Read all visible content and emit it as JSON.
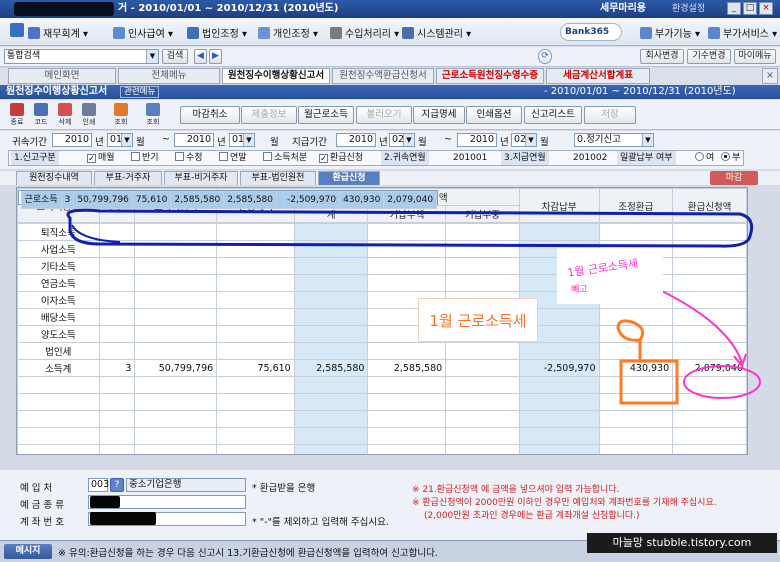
{
  "titlebar": {
    "title": "거 - 2010/01/01 ~ 2010/12/31 (2010년도)",
    "company": "세무마리용",
    "env": "환경설정"
  },
  "menu": [
    "재무회계",
    "인사급여",
    "법인조정",
    "개인조정",
    "수입처리리",
    "시스템관리",
    "Bank365",
    "부가기능",
    "부가서비스"
  ],
  "searchbar": {
    "search_label": "통합검색",
    "search_btn": "검색",
    "right_buttons": [
      "회사변경",
      "기수변경",
      "마이메뉴"
    ]
  },
  "tabs": [
    {
      "label": "메인화면",
      "state": "normal"
    },
    {
      "label": "전체메뉴",
      "state": "normal"
    },
    {
      "label": "원천징수이행상황신고서",
      "state": "active"
    },
    {
      "label": "원천징수액환급신청서",
      "state": "normal"
    },
    {
      "label": "근로소득원천징수영수증",
      "state": "red"
    },
    {
      "label": "세금계산서합계표",
      "state": "red"
    }
  ],
  "form_header": {
    "title": "원천징수이행상황신고서",
    "menu": "관련메뉴",
    "period": "- 2010/01/01 ~ 2010/12/31 (2010년도)"
  },
  "toolbar": {
    "icons": [
      "종료",
      "코드",
      "삭제",
      "인쇄",
      "조회",
      "조회"
    ],
    "buttons": [
      {
        "label": "마감취소",
        "enabled": true
      },
      {
        "label": "제출정보",
        "enabled": false
      },
      {
        "label": "월근로소득",
        "enabled": true
      },
      {
        "label": "불러오기",
        "enabled": false
      },
      {
        "label": "지급명세",
        "enabled": true
      },
      {
        "label": "인쇄옵션",
        "enabled": true
      },
      {
        "label": "신고리스트",
        "enabled": true
      },
      {
        "label": "저장",
        "enabled": false
      }
    ]
  },
  "filter": {
    "attr_label": "귀속기간",
    "pay_label": "지급기간",
    "attr_from_year": "2010",
    "attr_from_month": "01",
    "attr_to_year": "2010",
    "attr_to_month": "01",
    "pay_from_year": "2010",
    "pay_from_month": "02",
    "pay_to_year": "2010",
    "pay_to_month": "02",
    "year_unit": "년",
    "month_unit": "월",
    "tilde": "~",
    "report_type": "0.정기신고",
    "row2": {
      "declare_label": "1.신고구분",
      "opts": [
        "매월",
        "반기",
        "수정",
        "연말",
        "소득처분",
        "환급신청"
      ],
      "opts_checked": [
        true,
        false,
        false,
        false,
        false,
        true
      ],
      "attr_ym_label": "2.귀속연월",
      "attr_ym": "201001",
      "pay_ym_label": "3.지급연월",
      "pay_ym": "201002",
      "batch_label": "일괄납부 여부",
      "yes": "여",
      "no": "부"
    }
  },
  "subtabs": [
    "원천징수내역",
    "부표-거주자",
    "부표-비거주자",
    "부표-법인원천",
    "환급신청"
  ],
  "subtab_active": 4,
  "close_button": "마감",
  "grid": {
    "headers": {
      "col1": "소득의종류",
      "col2": "인원",
      "col3": "소득지급액",
      "col4": "결정세액",
      "group": "기납부 원천징수세액",
      "sub1": "계",
      "sub2": "기납부액",
      "sub3": "기납부중",
      "col6": "차감납부",
      "col7": "조정환급",
      "col8": "환급신청액"
    },
    "rows": [
      {
        "label": "근로소득",
        "count": "3",
        "paid": "50,799,796",
        "tax": "75,610",
        "sum": "2,585,580",
        "prev": "2,585,580",
        "sub": "",
        "diff": "-2,509,970",
        "adj": "430,930",
        "refund": "2,079,040",
        "selected": true
      },
      {
        "label": "퇴직소득",
        "count": "",
        "paid": "",
        "tax": "",
        "sum": "",
        "prev": "",
        "sub": "",
        "diff": "",
        "adj": "",
        "refund": ""
      },
      {
        "label": "사업소득",
        "count": "",
        "paid": "",
        "tax": "",
        "sum": "",
        "prev": "",
        "sub": "",
        "diff": "",
        "adj": "",
        "refund": ""
      },
      {
        "label": "기타소득",
        "count": "",
        "paid": "",
        "tax": "",
        "sum": "",
        "prev": "",
        "sub": "",
        "diff": "",
        "adj": "",
        "refund": ""
      },
      {
        "label": "연금소득",
        "count": "",
        "paid": "",
        "tax": "",
        "sum": "",
        "prev": "",
        "sub": "",
        "diff": "",
        "adj": "",
        "refund": ""
      },
      {
        "label": "이자소득",
        "count": "",
        "paid": "",
        "tax": "",
        "sum": "",
        "prev": "",
        "sub": "",
        "diff": "",
        "adj": "",
        "refund": ""
      },
      {
        "label": "배당소득",
        "count": "",
        "paid": "",
        "tax": "",
        "sum": "",
        "prev": "",
        "sub": "",
        "diff": "",
        "adj": "",
        "refund": ""
      },
      {
        "label": "양도소득",
        "count": "",
        "paid": "",
        "tax": "",
        "sum": "",
        "prev": "",
        "sub": "",
        "diff": "",
        "adj": "",
        "refund": ""
      },
      {
        "label": "법인세",
        "count": "",
        "paid": "",
        "tax": "",
        "sum": "",
        "prev": "",
        "sub": "",
        "diff": "",
        "adj": "",
        "refund": ""
      },
      {
        "label": "소득계",
        "count": "3",
        "paid": "50,799,796",
        "tax": "75,610",
        "sum": "2,585,580",
        "prev": "2,585,580",
        "sub": "",
        "diff": "-2,509,970",
        "adj": "430,930",
        "refund": "2,079,040"
      }
    ]
  },
  "bottom": {
    "deposit_label": "예 입 처",
    "deposit_code": "003",
    "deposit_name": "중소기업은행",
    "account_type_label": "예 금 종 류",
    "account_no_label": "계 좌 번 호",
    "hint1": "* 환급받을 은행",
    "hint2": "* \"-\"를 제외하고 입력해 주십시요.",
    "notes": [
      "※ 21.환급신청액 에 금액을 넣으셔야 입력 가능합니다.",
      "※ 환급신청액이 2000만원 이하인 경우만 예입처와 계좌번호를 기재해 주십시요.",
      "(2,000만원 초과인 경우에는 환급 계좌개설 신청합니다.)"
    ]
  },
  "statusbar": {
    "msg_label": "메시지",
    "text": "※ 유의:환급신청을 하는 경우 다음 신고시 13.기환급신청에 환급신청액을 입력하여 신고합니다."
  },
  "watermark": "마늘망 stubble.tistory.com",
  "annotations": {
    "callout": "1월 근로소득세",
    "pink_line1": "1월 근로소득세",
    "pink_line2": "빼고"
  },
  "colors": {
    "annotation_blue": "#1020b0",
    "annotation_pink": "#ff33cc",
    "annotation_orange": "#ff7a20"
  }
}
